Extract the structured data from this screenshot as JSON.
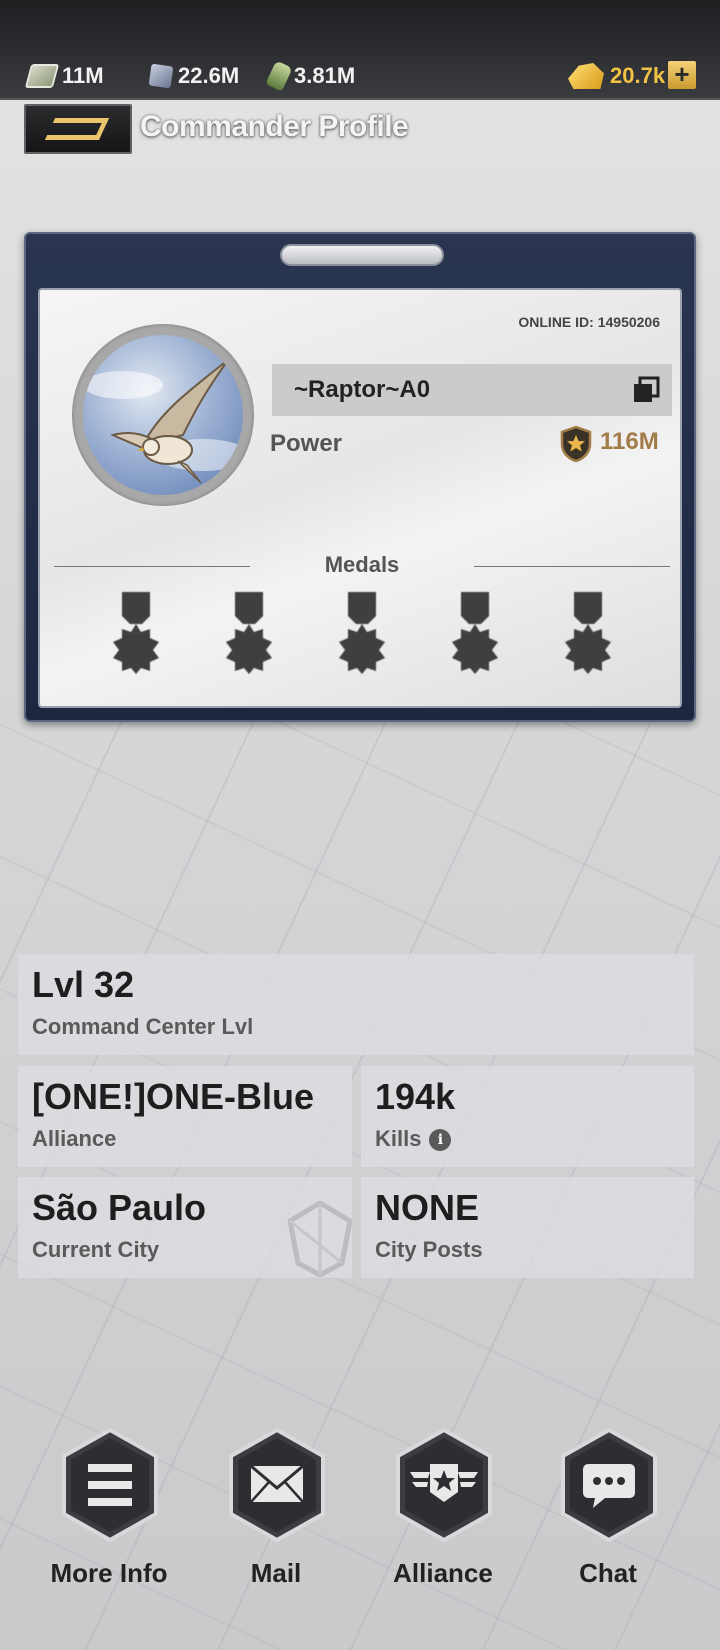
{
  "resources": [
    {
      "icon": "cash-icon",
      "value": "11M"
    },
    {
      "icon": "supply-box-icon",
      "value": "22.6M"
    },
    {
      "icon": "oil-bottle-icon",
      "value": "3.81M"
    }
  ],
  "gold": {
    "icon": "gold-bars-icon",
    "value": "20.7k",
    "plus_label": "+"
  },
  "header": {
    "title": "Commander Profile"
  },
  "profile": {
    "online_id": "ONLINE ID: 14950206",
    "name": "~Raptor~A0",
    "power_label": "Power",
    "power_value": "116M",
    "medals_label": "Medals",
    "medal_count": 5
  },
  "stats": {
    "level": {
      "value": "Lvl 32",
      "label": "Command Center Lvl"
    },
    "alliance": {
      "value": "[ONE!]ONE-Blue",
      "label": "Alliance"
    },
    "kills": {
      "value": "194k",
      "label": "Kills",
      "info_icon": "i"
    },
    "city": {
      "value": "São Paulo",
      "label": "Current City"
    },
    "posts": {
      "value": "NONE",
      "label": "City Posts"
    }
  },
  "actions": [
    {
      "icon": "menu-icon",
      "label": "More Info"
    },
    {
      "icon": "mail-icon",
      "label": "Mail"
    },
    {
      "icon": "alliance-emblem-icon",
      "label": "Alliance"
    },
    {
      "icon": "chat-bubble-icon",
      "label": "Chat"
    }
  ],
  "colors": {
    "accent_gold": "#f1c244",
    "power": "#a27c48",
    "card_frame": "#1d2740"
  }
}
